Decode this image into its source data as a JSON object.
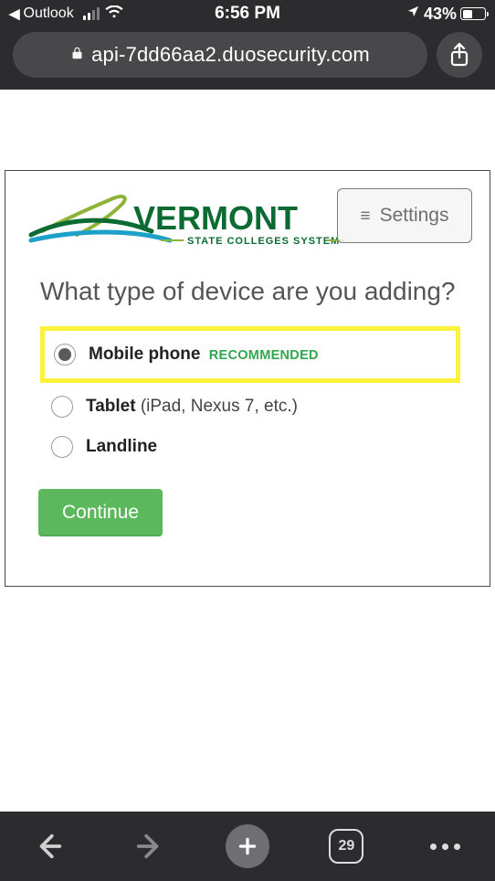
{
  "statusBar": {
    "backApp": "Outlook",
    "time": "6:56 PM",
    "batteryPercent": "43%",
    "batteryFillPercent": 43
  },
  "urlBar": {
    "host": "api-7dd66aa2.duosecurity.com"
  },
  "settings": {
    "label": "Settings"
  },
  "logo": {
    "brand": "VERMONT",
    "tagline": "STATE COLLEGES SYSTEM"
  },
  "question": "What type of device are you adding?",
  "options": [
    {
      "label": "Mobile phone",
      "badge": "RECOMMENDED",
      "note": "",
      "selected": true,
      "highlight": true
    },
    {
      "label": "Tablet",
      "badge": "",
      "note": " (iPad, Nexus 7, etc.)",
      "selected": false,
      "highlight": false
    },
    {
      "label": "Landline",
      "badge": "",
      "note": "",
      "selected": false,
      "highlight": false
    }
  ],
  "continueLabel": "Continue",
  "bottomBar": {
    "tabCount": "29"
  }
}
